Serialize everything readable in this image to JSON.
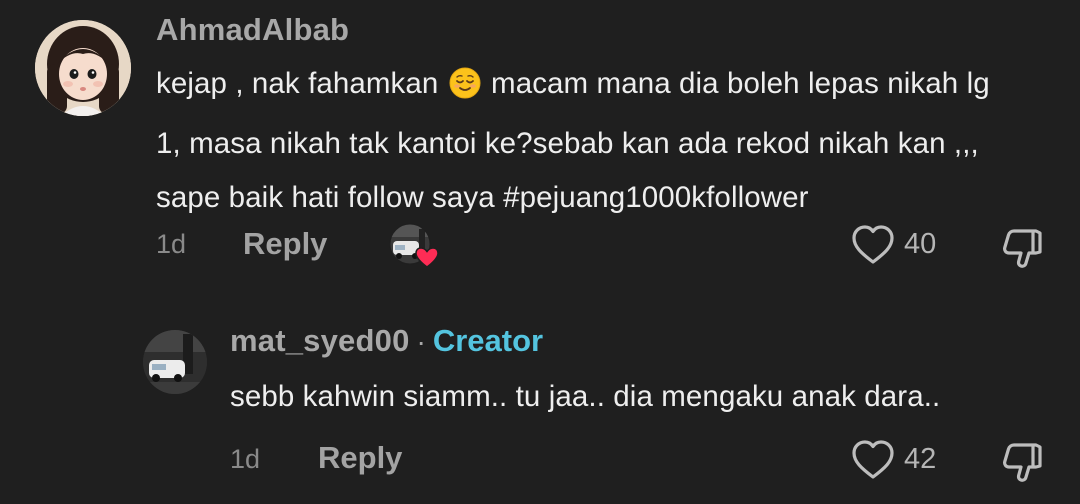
{
  "comments": [
    {
      "username": "AhmadAlbab",
      "text_before_emoji": "kejap , nak fahamkan ",
      "emoji": "relieved-face-emoji",
      "text_after_emoji": " macam mana dia boleh lepas nikah lg",
      "text_line2": "1, masa nikah tak kantoi ke?sebab kan ada rekod nikah kan ,,,",
      "text_line3": "sape baik hati follow saya #pejuang1000kfollower",
      "time": "1d",
      "reply_label": "Reply",
      "likes": "40"
    },
    {
      "username": "mat_syed00",
      "separator": "·",
      "badge": "Creator",
      "text": "sebb kahwin siamm.. tu jaa.. dia mengaku anak dara..",
      "time": "1d",
      "reply_label": "Reply",
      "likes": "42"
    }
  ],
  "colors": {
    "background": "#1f1f1f",
    "creator_badge": "#54c4df",
    "reactor_heart": "#fe2c55"
  },
  "icons": {
    "like": "heart-outline-icon",
    "dislike": "thumbs-down-outline-icon",
    "creator_liked": "heart-filled-icon"
  }
}
